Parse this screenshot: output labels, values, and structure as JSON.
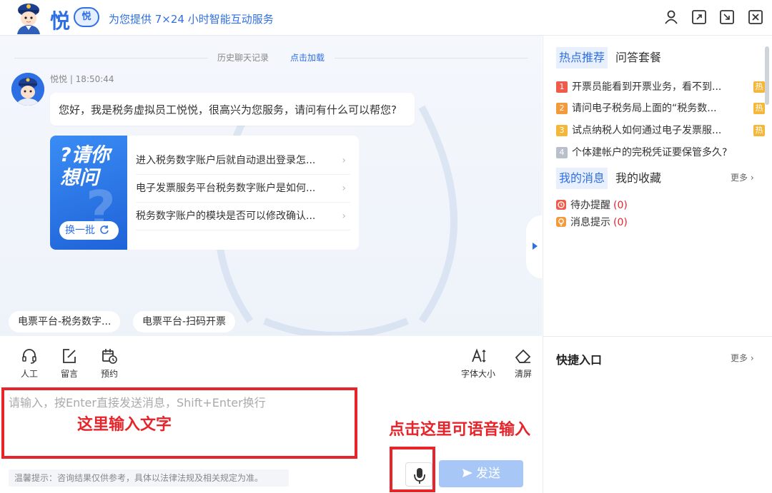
{
  "header": {
    "logo_char": "悦",
    "logo_badge": "悦",
    "slogan": "为您提供 7×24 小时智能互动服务"
  },
  "chat": {
    "history_label": "历史聊天记录",
    "history_link": "点击加载",
    "bot_meta": "悦悦 | 18:50:44",
    "greeting": "您好，我是税务虚拟员工悦悦，很高兴为您服务，请问有什么可以帮您?",
    "card_title_line1": "?请你",
    "card_title_line2": "想问",
    "refresh_label": "换一批",
    "questions": [
      "进入税务数字账户后就自动退出登录怎...",
      "电子发票服务平台税务数字账户是如何...",
      "税务数字账户的模块是否可以修改确认..."
    ],
    "chips": [
      "电票平台-税务数字...",
      "电票平台-扫码开票"
    ]
  },
  "toolbar": {
    "human_label": "人工",
    "message_label": "留言",
    "booking_label": "预约",
    "font_size_label": "字体大小",
    "clear_label": "清屏"
  },
  "input": {
    "placeholder": "请输入，按Enter直接发送消息，Shift+Enter换行",
    "send_label": "发送",
    "tip": "温馨提示：咨询结果仅供参考，具体以法律法规及相关规定为准。"
  },
  "annotations": {
    "input_hint": "这里输入文字",
    "voice_hint": "点击这里可语音输入",
    "color": "#e6242a"
  },
  "right": {
    "tab_hot": "热点推荐",
    "tab_qa": "问答套餐",
    "hot_items": [
      {
        "num": "1",
        "text": "开票员能看到开票业务，看不到...",
        "tag": "热",
        "color": "#f05a4a"
      },
      {
        "num": "2",
        "text": "请问电子税务局上面的“税务数...",
        "tag": "热",
        "color": "#f39a3d"
      },
      {
        "num": "3",
        "text": "试点纳税人如何通过电子发票服...",
        "tag": "热",
        "color": "#f4b73a"
      },
      {
        "num": "4",
        "text": "个体建帐户的完税凭证要保管多久?",
        "tag": "",
        "color": "#b9c0cc"
      }
    ],
    "tab_msg": "我的消息",
    "tab_fav": "我的收藏",
    "more": "更多",
    "todo_label": "待办提醒",
    "todo_count": "(0)",
    "notice_label": "消息提示",
    "notice_count": "(0)",
    "quick_title": "快捷入口",
    "quick_more": "更多"
  },
  "colors": {
    "brand": "#2f6fe4",
    "send_disabled": "#a7c8f7",
    "hot_tag": "#f4b73a"
  }
}
